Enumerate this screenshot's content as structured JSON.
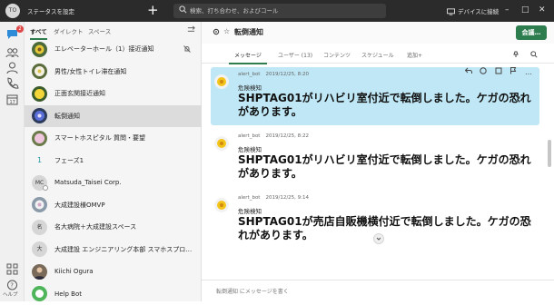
{
  "topbar": {
    "status_initials": "TO",
    "status_text": "ステータスを設定",
    "search_placeholder": "検索、打ち合わせ、およびコール",
    "device_label": "デバイスに接続"
  },
  "rail": {
    "notification_count": "2",
    "help_label": "ヘルプ"
  },
  "sidebar": {
    "tabs": [
      "すべて",
      "ダイレクト",
      "スペース"
    ],
    "active_tab": "すべて",
    "items": [
      {
        "label": "エレベーターホール（1）接近通知",
        "avatar": "flower-yellow",
        "muted": true
      },
      {
        "label": "男性/女性トイレ滞在通知",
        "avatar": "flower-white"
      },
      {
        "label": "正面玄関接近通知",
        "avatar": "flower-yellow2"
      },
      {
        "label": "転倒通知",
        "avatar": "flower-blue",
        "selected": true
      },
      {
        "label": "スマートホスピタル 質問・要望",
        "avatar": "flower-pink"
      },
      {
        "label": "フェーズ1",
        "avatar_text": "1"
      },
      {
        "label": "Matsuda_Taisei Corp.",
        "avatar_text": "MC"
      },
      {
        "label": "大成建設様OMVP",
        "avatar": "photo-flower"
      },
      {
        "label": "名大病院＋大成建設スペース",
        "avatar_text": "名"
      },
      {
        "label": "大成建設 エンジニアリング本部 スマホスプロジェクト…",
        "avatar_text": "大"
      },
      {
        "label": "Kiichi Ogura",
        "avatar": "person"
      },
      {
        "label": "Help Bot",
        "avatar": "bot"
      }
    ]
  },
  "channel": {
    "title": "転倒通知",
    "meet_label": "会議…",
    "tabs": [
      "メッセージ",
      "ユーザー (13)",
      "コンテンツ",
      "スケジュール",
      "追加"
    ],
    "active_tab": "メッセージ"
  },
  "messages": [
    {
      "sender": "alert_bot",
      "time": "2019/12/25, 8:20",
      "subject": "危険検知",
      "body": "SHPTAG01がリハビリ室付近で転倒しました。ケガの恐れがあります。",
      "highlighted": true
    },
    {
      "sender": "alert_bot",
      "time": "2019/12/25, 8:22",
      "subject": "危険検知",
      "body": "SHPTAG01がリハビリ室付近で転倒しました。ケガの恐れがあります。",
      "highlighted": false
    },
    {
      "sender": "alert_bot",
      "time": "2019/12/25, 9:14",
      "subject": "危険検知",
      "body": "SHPTAG01が売店自販機横付近で転倒しました。ケガの恐れがあります。",
      "highlighted": false
    }
  ],
  "composer": {
    "placeholder": "転倒通知 にメッセージを書く"
  },
  "colors": {
    "accent": "#2e7d4f",
    "highlight": "#bfe7f5",
    "topbar": "#2b2b2b"
  }
}
